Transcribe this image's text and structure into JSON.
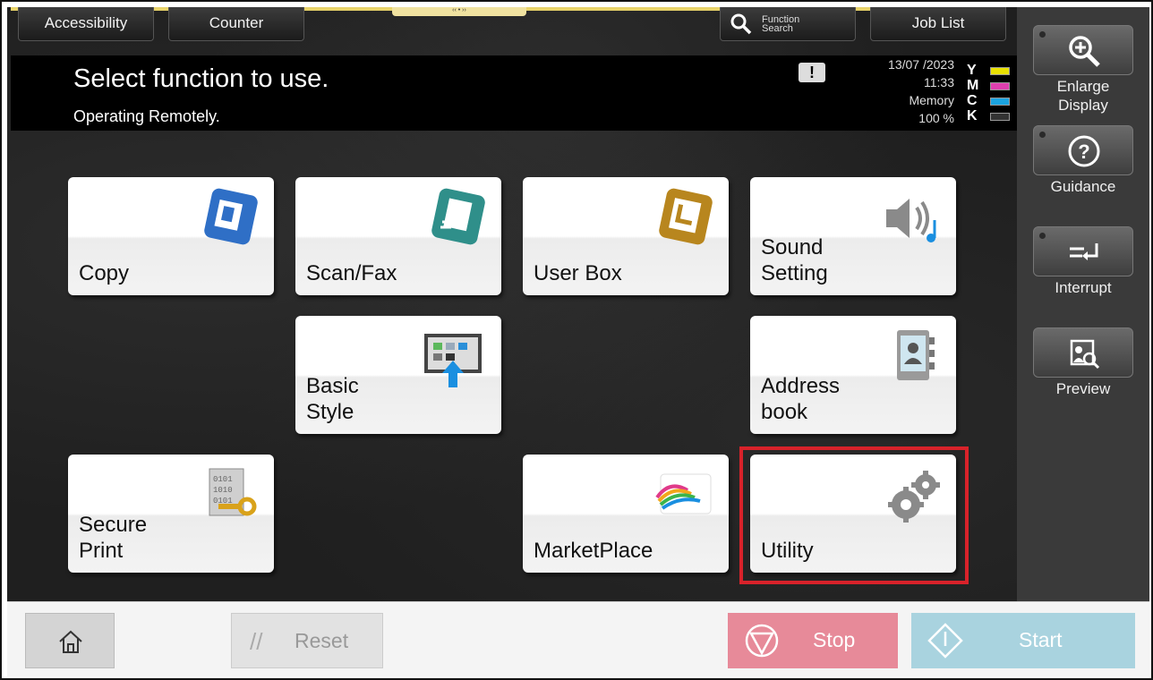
{
  "top_tabs": {
    "accessibility": "Accessibility",
    "counter": "Counter",
    "function_search_line1": "Function",
    "function_search_line2": "Search",
    "job_list": "Job List"
  },
  "message": {
    "title": "Select function to use.",
    "subtitle": "Operating Remotely."
  },
  "status": {
    "date": "13/07 /2023",
    "time": "11:33",
    "memory_label": "Memory",
    "memory_value": "100 %"
  },
  "toner": [
    {
      "letter": "Y",
      "color": "#e8e000"
    },
    {
      "letter": "M",
      "color": "#e040b0"
    },
    {
      "letter": "C",
      "color": "#1ba3e0"
    },
    {
      "letter": "K",
      "color": "#333333"
    }
  ],
  "tiles": {
    "copy": "Copy",
    "scan_fax": "Scan/Fax",
    "user_box": "User Box",
    "sound_setting": "Sound\nSetting",
    "basic_style": "Basic\nStyle",
    "address_book": "Address\nbook",
    "secure_print": "Secure\nPrint",
    "marketplace": "MarketPlace",
    "utility": "Utility"
  },
  "side_panel": {
    "enlarge_display": "Enlarge\nDisplay",
    "guidance": "Guidance",
    "interrupt": "Interrupt",
    "preview": "Preview"
  },
  "bottom_bar": {
    "reset": "Reset",
    "stop": "Stop",
    "start": "Start"
  },
  "colors": {
    "highlight": "#d8222a",
    "stop": "#e78a99",
    "start": "#a9d3df"
  }
}
